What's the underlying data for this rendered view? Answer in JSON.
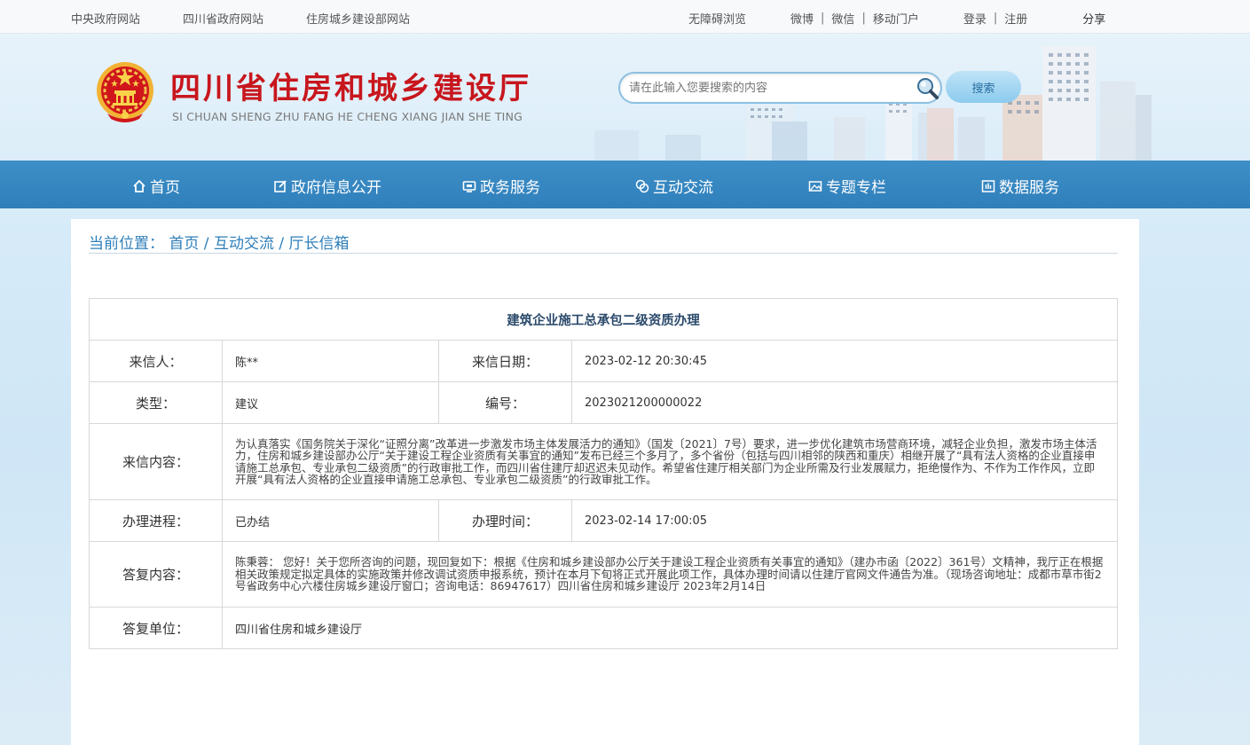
{
  "topbar": {
    "links": [
      "中央政府网站",
      "四川省政府网站",
      "住房城乡建设部网站"
    ],
    "accessibility": "无障碍浏览",
    "weibo": "微博",
    "wechat": "微信",
    "mobile": "移动门户",
    "login": "登录",
    "register": "注册",
    "share": "分享"
  },
  "header": {
    "title": "四川省住房和城乡建设厅",
    "subtitle": "SI CHUAN SHENG ZHU FANG HE CHENG XIANG JIAN SHE TING",
    "search_placeholder": "请在此输入您要搜索的内容",
    "search_button": "搜索"
  },
  "nav": {
    "items": [
      {
        "label": "首页",
        "icon": "home-icon"
      },
      {
        "label": "政府信息公开",
        "icon": "edit-icon"
      },
      {
        "label": "政务服务",
        "icon": "monitor-icon"
      },
      {
        "label": "互动交流",
        "icon": "chat-icon"
      },
      {
        "label": "专题专栏",
        "icon": "image-icon"
      },
      {
        "label": "数据服务",
        "icon": "data-icon"
      }
    ]
  },
  "breadcrumb": {
    "prefix": "当前位置：",
    "items": [
      "首页",
      "互动交流",
      "厅长信箱"
    ],
    "separator": " / "
  },
  "letter": {
    "title": "建筑企业施工总承包二级资质办理",
    "sender_label": "来信人：",
    "sender": "陈**",
    "date_label": "来信日期：",
    "date": "2023-02-12 20:30:45",
    "type_label": "类型：",
    "type": "建议",
    "number_label": "编号：",
    "number": "2023021200000022",
    "content_label": "来信内容：",
    "content": "为认真落实《国务院关于深化“证照分离”改革进一步激发市场主体发展活力的通知》（国发〔2021〕7号）要求，进一步优化建筑市场营商环境，减轻企业负担，激发市场主体活力，住房和城乡建设部办公厅“关于建设工程企业资质有关事宜的通知”发布已经三个多月了，多个省份（包括与四川相邻的陕西和重庆）相继开展了“具有法人资格的企业直接申请施工总承包、专业承包二级资质”的行政审批工作，而四川省住建厅却迟迟未见动作。希望省住建厅相关部门为企业所需及行业发展赋力，拒绝慢作为、不作为工作作风，立即开展“具有法人资格的企业直接申请施工总承包、专业承包二级资质”的行政审批工作。",
    "progress_label": "办理进程：",
    "progress": "已办结",
    "handle_time_label": "办理时间：",
    "handle_time": "2023-02-14 17:00:05",
    "reply_label": "答复内容：",
    "reply": "陈秉蓉： 您好！关于您所咨询的问题，现回复如下：根据《住房和城乡建设部办公厅关于建设工程企业资质有关事宜的通知》（建办市函〔2022〕361号）文精神，我厅正在根据相关政策规定拟定具体的实施政策并修改调试资质申报系统，预计在本月下旬将正式开展此项工作，具体办理时间请以住建厅官网文件通告为准。（现场咨询地址：成都市草市街2号省政务中心六楼住房城乡建设厅窗口；咨询电话：86947617）四川省住房和城乡建设厅 2023年2月14日",
    "reply_unit_label": "答复单位：",
    "reply_unit": "四川省住房和城乡建设厅"
  },
  "colors": {
    "brand_red": "#c8161d",
    "nav_blue": "#2f7fbb",
    "link_blue": "#2f7fbb"
  }
}
